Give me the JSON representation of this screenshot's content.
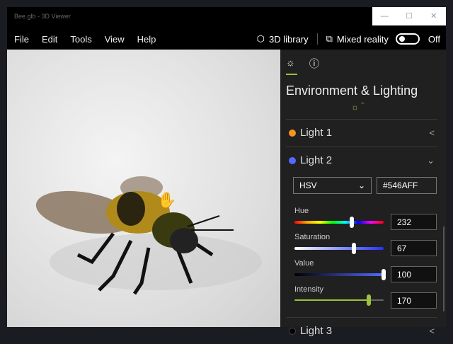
{
  "window": {
    "title": "Bee.glb - 3D Viewer",
    "minimize": "—",
    "maximize": "☐",
    "close": "✕"
  },
  "menu": [
    "File",
    "Edit",
    "Tools",
    "View",
    "Help"
  ],
  "toolbar": {
    "library": "3D library",
    "mixed_reality": "Mixed reality",
    "toggle_state": "Off"
  },
  "panel": {
    "heading": "Environment & Lighting",
    "lights": [
      {
        "label": "Light 1",
        "color": "#f7931e"
      },
      {
        "label": "Light 2",
        "color": "#546aff"
      },
      {
        "label": "Light 3",
        "color": "#000000"
      }
    ],
    "mode": "HSV",
    "hex": "#546AFF",
    "sliders": [
      {
        "label": "Hue",
        "value": "232",
        "fraction": 0.64
      },
      {
        "label": "Saturation",
        "value": "67",
        "fraction": 0.67
      },
      {
        "label": "Value",
        "value": "100",
        "fraction": 1.0
      },
      {
        "label": "Intensity",
        "value": "170",
        "fraction": 0.83
      }
    ]
  },
  "accent": "#9ac23c"
}
